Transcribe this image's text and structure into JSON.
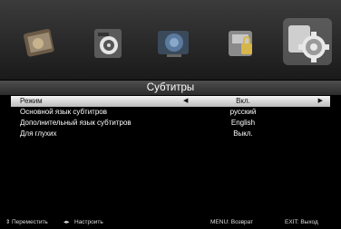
{
  "menu_icons": [
    {
      "name": "picture-icon",
      "active": false
    },
    {
      "name": "sound-icon",
      "active": false
    },
    {
      "name": "channel-icon",
      "active": false
    },
    {
      "name": "lock-icon",
      "active": false
    },
    {
      "name": "settings-icon",
      "active": true
    }
  ],
  "title": "Субтитры",
  "rows": [
    {
      "label": "Режим",
      "value": "Вкл."
    },
    {
      "label": "Основной язык субтитров",
      "value": "русский"
    },
    {
      "label": "Дополнительный язык субтитров",
      "value": "English"
    },
    {
      "label": "Для глухих",
      "value": "Выкл."
    }
  ],
  "footer": {
    "move_glyph": "⇕",
    "move": "Переместить",
    "adjust_glyph": "◂▸",
    "adjust": "Настроить",
    "back": "MENU: Возврат",
    "exit": "EXIT: Выход"
  }
}
